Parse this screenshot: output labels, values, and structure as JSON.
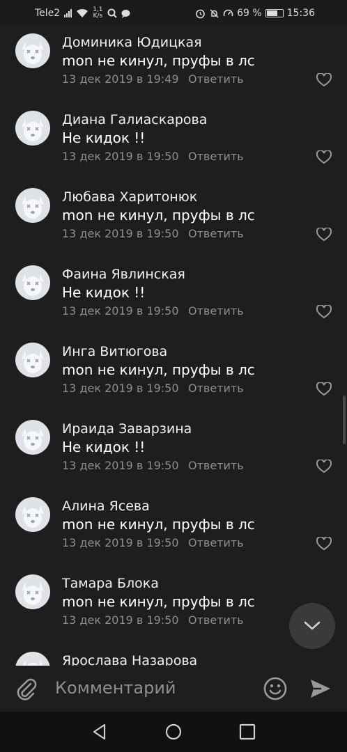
{
  "status_bar": {
    "carrier": "Tele2",
    "speed_value": "1,1",
    "speed_unit": "K/s",
    "battery": "69 %",
    "time": "15:36",
    "battery_level": 0.69
  },
  "comments": [
    {
      "name": "Доминика Юдицкая",
      "text": "mon не кинул, пруфы в лс",
      "date": "13 дек 2019 в 19:49",
      "reply": "Ответить"
    },
    {
      "name": "Диана Галиаскарова",
      "text": "Не кидок !!",
      "date": "13 дек 2019 в 19:50",
      "reply": "Ответить"
    },
    {
      "name": "Любава Харитонюк",
      "text": "mon не кинул, пруфы в лс",
      "date": "13 дек 2019 в 19:50",
      "reply": "Ответить"
    },
    {
      "name": "Фаина Явлинская",
      "text": "Не кидок !!",
      "date": "13 дек 2019 в 19:50",
      "reply": "Ответить"
    },
    {
      "name": "Инга Витюгова",
      "text": "mon не кинул, пруфы в лс",
      "date": "13 дек 2019 в 19:50",
      "reply": "Ответить"
    },
    {
      "name": "Ираида Заварзина",
      "text": "Не кидок !!",
      "date": "13 дек 2019 в 19:50",
      "reply": "Ответить"
    },
    {
      "name": "Алина Ясева",
      "text": "mon не кинул, пруфы в лс",
      "date": "13 дек 2019 в 19:50",
      "reply": "Ответить"
    },
    {
      "name": "Тамара Блока",
      "text": "mon не кинул, пруфы в лс",
      "date": "13 дек 2019 в 19:50",
      "reply": "Ответить"
    },
    {
      "name": "Ярослава Назарова",
      "text": "",
      "date": "",
      "reply": ""
    }
  ],
  "input": {
    "placeholder": "Комментарий"
  },
  "icons": {
    "avatar": "deactivated-dog-avatar",
    "like": "heart-outline-icon",
    "scroll_down": "chevron-down-icon",
    "attach": "paperclip-icon",
    "emoji": "smiley-icon",
    "send": "send-arrow-icon",
    "nav": [
      "back-triangle-icon",
      "home-circle-icon",
      "recents-square-icon"
    ]
  },
  "colors": {
    "background": "#1e1e1e",
    "secondary_text": "#8e8e8e",
    "fab": "#3a3a3a"
  }
}
